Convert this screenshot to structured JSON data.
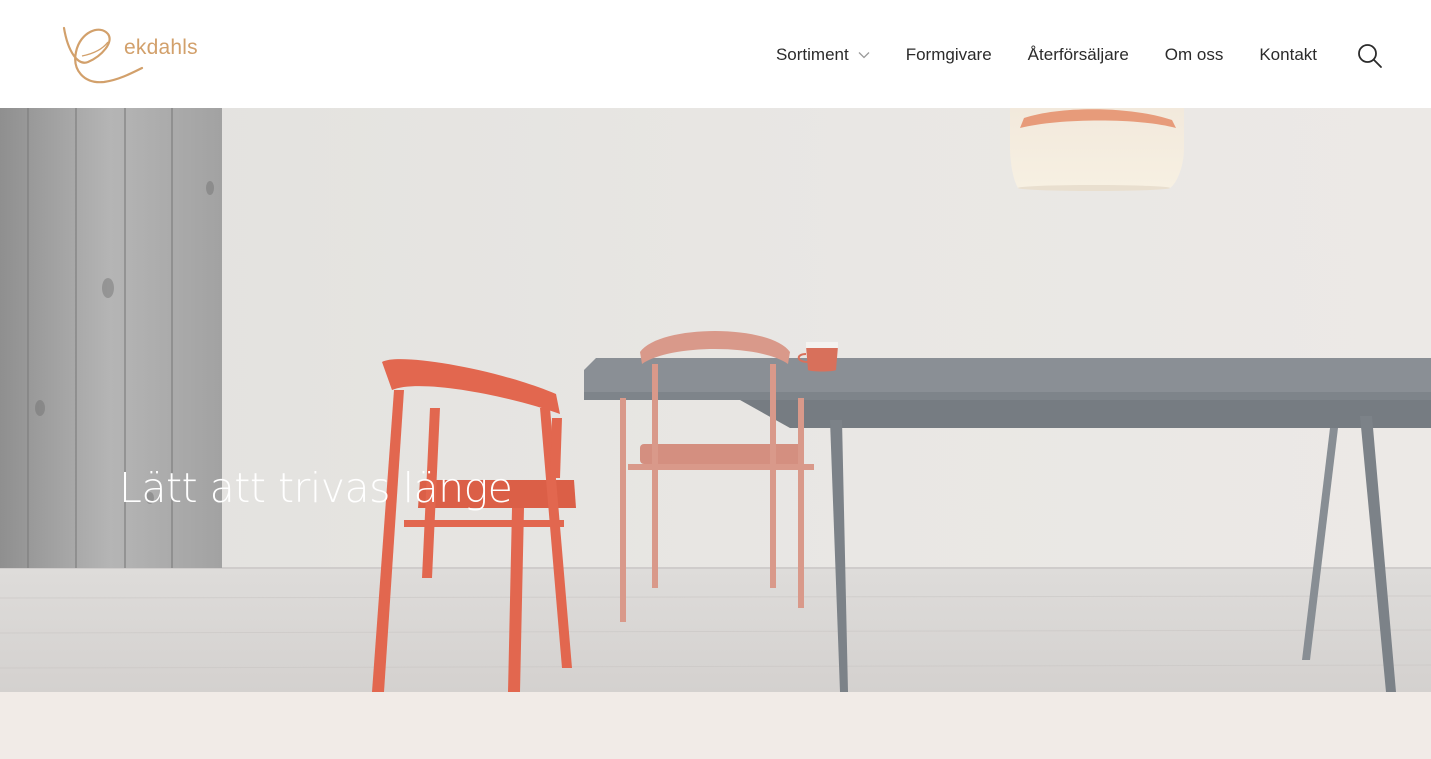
{
  "brand": {
    "name": "ekdahls",
    "accent_color": "#d2a06b"
  },
  "nav": {
    "items": [
      {
        "label": "Sortiment",
        "has_dropdown": true
      },
      {
        "label": "Formgivare"
      },
      {
        "label": "Återförsäljare"
      },
      {
        "label": "Om oss"
      },
      {
        "label": "Kontakt"
      }
    ],
    "search_icon": "search-icon"
  },
  "hero": {
    "title": "Lätt att trivas länge"
  },
  "colors": {
    "section_background": "#f1ebe7",
    "text": "#2b2b2b"
  }
}
